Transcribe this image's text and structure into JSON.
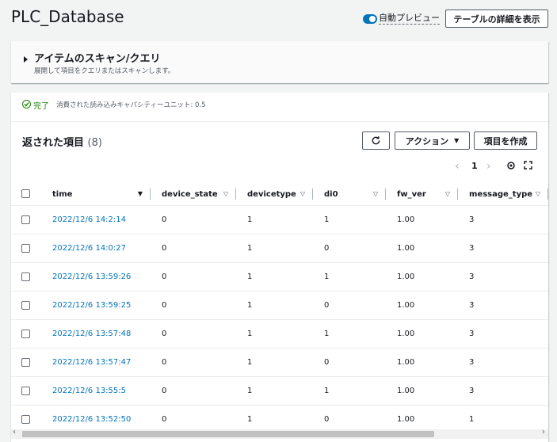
{
  "page": {
    "title": "PLC_Database"
  },
  "header": {
    "auto_preview_label": "自動プレビュー",
    "table_details_button": "テーブルの詳細を表示"
  },
  "scan": {
    "title": "アイテムのスキャン/クエリ",
    "description": "展開して項目をクエリまたはスキャンします。"
  },
  "status": {
    "text": "完了",
    "capacity": "消費された読み込みキャパシティーユニット: 0.5"
  },
  "items": {
    "title": "返された項目",
    "count": "(8)"
  },
  "toolbar": {
    "action_button": "アクション",
    "create_button": "項目を作成",
    "refresh_icon": "refresh-icon"
  },
  "pagination": {
    "current_page": "1"
  },
  "table": {
    "columns": [
      "time",
      "device_state",
      "devicetype",
      "di0",
      "fw_ver",
      "message_type"
    ],
    "rows": [
      [
        "2022/12/6 14:2:14",
        "0",
        "1",
        "1",
        "1.00",
        "3"
      ],
      [
        "2022/12/6 14:0:27",
        "0",
        "1",
        "0",
        "1.00",
        "3"
      ],
      [
        "2022/12/6 13:59:26",
        "0",
        "1",
        "1",
        "1.00",
        "3"
      ],
      [
        "2022/12/6 13:59:25",
        "0",
        "1",
        "0",
        "1.00",
        "3"
      ],
      [
        "2022/12/6 13:57:48",
        "0",
        "1",
        "1",
        "1.00",
        "3"
      ],
      [
        "2022/12/6 13:57:47",
        "0",
        "1",
        "0",
        "1.00",
        "3"
      ],
      [
        "2022/12/6 13:55:5",
        "0",
        "1",
        "1",
        "1.00",
        "3"
      ],
      [
        "2022/12/6 13:52:50",
        "0",
        "1",
        "0",
        "1.00",
        "1"
      ]
    ]
  },
  "colors": {
    "accent": "#0073bb",
    "success": "#1d8102",
    "toggle": "#0073bb"
  }
}
